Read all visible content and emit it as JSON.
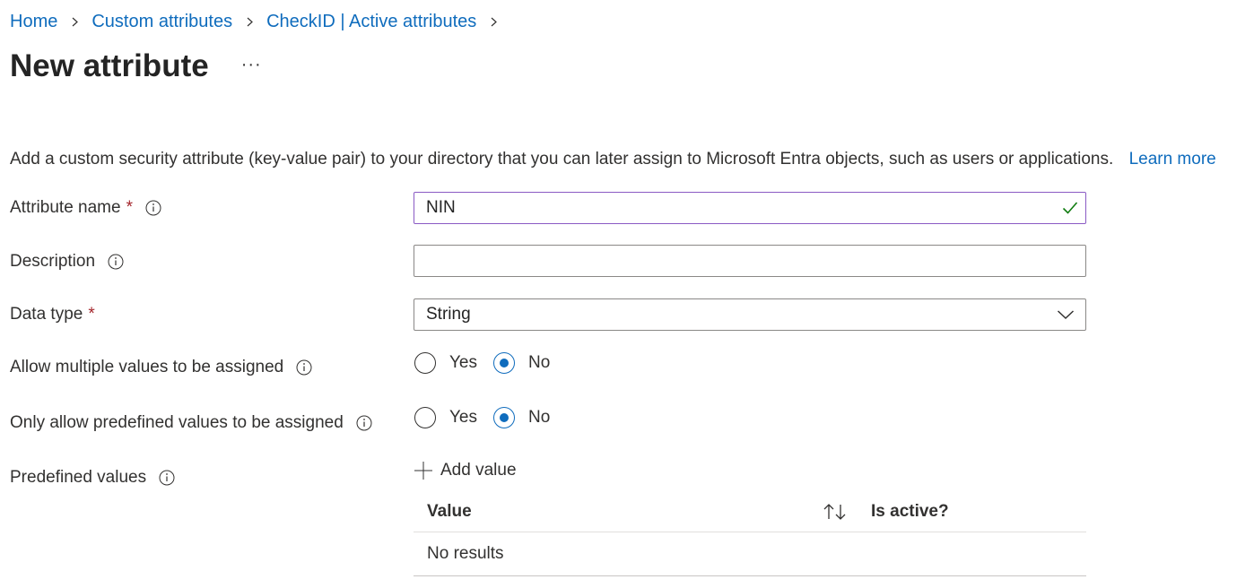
{
  "breadcrumb": {
    "items": [
      "Home",
      "Custom attributes",
      "CheckID | Active attributes"
    ]
  },
  "header": {
    "title": "New attribute",
    "more_label": "···"
  },
  "intro": {
    "text": "Add a custom security attribute (key-value pair) to your directory that you can later assign to Microsoft Entra objects, such as users or applications.",
    "learn_more": "Learn more"
  },
  "form": {
    "attribute_name": {
      "label": "Attribute name",
      "required_mark": "*",
      "value": "NIN"
    },
    "description": {
      "label": "Description",
      "value": ""
    },
    "data_type": {
      "label": "Data type",
      "required_mark": "*",
      "value": "String"
    },
    "allow_multiple": {
      "label": "Allow multiple values to be assigned",
      "options": [
        "Yes",
        "No"
      ],
      "selected": "No"
    },
    "only_predefined": {
      "label": "Only allow predefined values to be assigned",
      "options": [
        "Yes",
        "No"
      ],
      "selected": "No"
    },
    "predefined_values": {
      "label": "Predefined values",
      "add_label": "Add value",
      "columns": [
        "Value",
        "Is active?"
      ],
      "empty_text": "No results"
    }
  },
  "icons": {
    "info": "info-icon",
    "valid": "checkmark-icon",
    "dropdown": "chevron-down-icon",
    "add": "plus-icon",
    "sort": "sort-icon"
  },
  "colors": {
    "link": "#0f6cbd",
    "required": "#a4262c",
    "valid_check": "#107c10",
    "focus_border": "#8a5ac4",
    "radio_selected": "#0f6cbd"
  }
}
